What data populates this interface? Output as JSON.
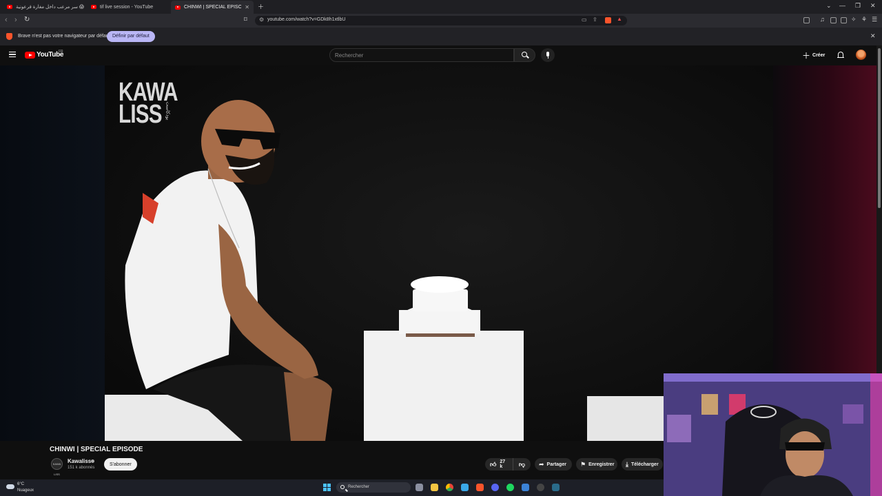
{
  "browser": {
    "tabs": [
      {
        "title": "سر مرعب داخل مغارة فرعونية 😱 :: ...",
        "active": false
      },
      {
        "title": "tif live session - YouTube",
        "active": false
      },
      {
        "title": "CHINWI | SPECIAL EPISODE - Yo...",
        "active": true
      }
    ],
    "url": "youtube.com/watch?v=GDk8h1xtlbU",
    "notification": {
      "message": "Brave n'est pas votre navigateur par défaut",
      "button": "Définir par défaut"
    }
  },
  "youtube": {
    "logo": "YouTube",
    "region": "FR",
    "search_placeholder": "Rechercher",
    "create_label": "Créer"
  },
  "video": {
    "watermark_line1": "KAWA",
    "watermark_line2": "LISS",
    "watermark_arabic": "بودكاست",
    "title": "CHINWI | SPECIAL EPISODE",
    "channel": {
      "name": "Kawaliss",
      "avatar_label": "KAWA LISS",
      "subscribers": "151 k abonnés",
      "subscribe_label": "S'abonner"
    },
    "actions": {
      "likes": "27 k",
      "share": "Partager",
      "save": "Enregistrer",
      "download": "Télécharger"
    }
  },
  "taskbar": {
    "weather_temp": "6°C",
    "weather_desc": "Nuageux",
    "search_label": "Rechercher"
  },
  "colors": {
    "youtube_red": "#ff0000",
    "brave_orange": "#fb542b",
    "notif_button": "#b9b6f5",
    "background": "#0f0f0f"
  }
}
